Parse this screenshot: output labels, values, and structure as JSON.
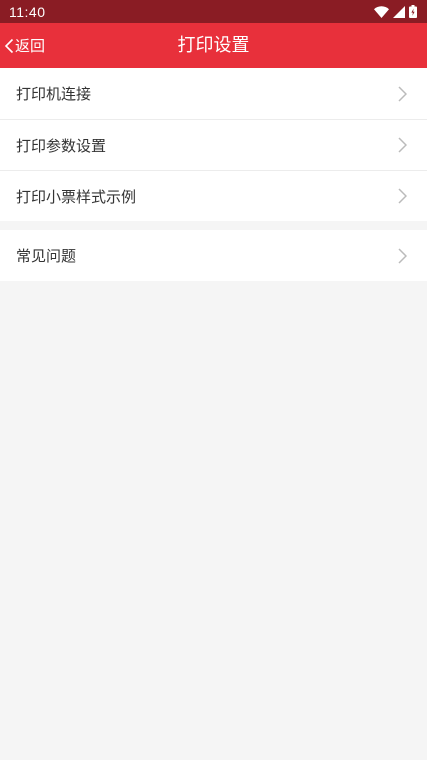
{
  "status_bar": {
    "time": "11:40",
    "icons": [
      "wifi-icon",
      "cell-signal-icon",
      "battery-icon"
    ]
  },
  "app_bar": {
    "back_label": "返回",
    "title": "打印设置"
  },
  "settings": {
    "group1": [
      {
        "label": "打印机连接"
      },
      {
        "label": "打印参数设置"
      },
      {
        "label": "打印小票样式示例"
      }
    ],
    "group2": [
      {
        "label": "常见问题"
      }
    ]
  },
  "colors": {
    "status_bar": "#8a1c24",
    "app_bar": "#e8303b",
    "background": "#f5f5f5",
    "row_text": "#333333",
    "chevron": "#bbbbbb"
  }
}
